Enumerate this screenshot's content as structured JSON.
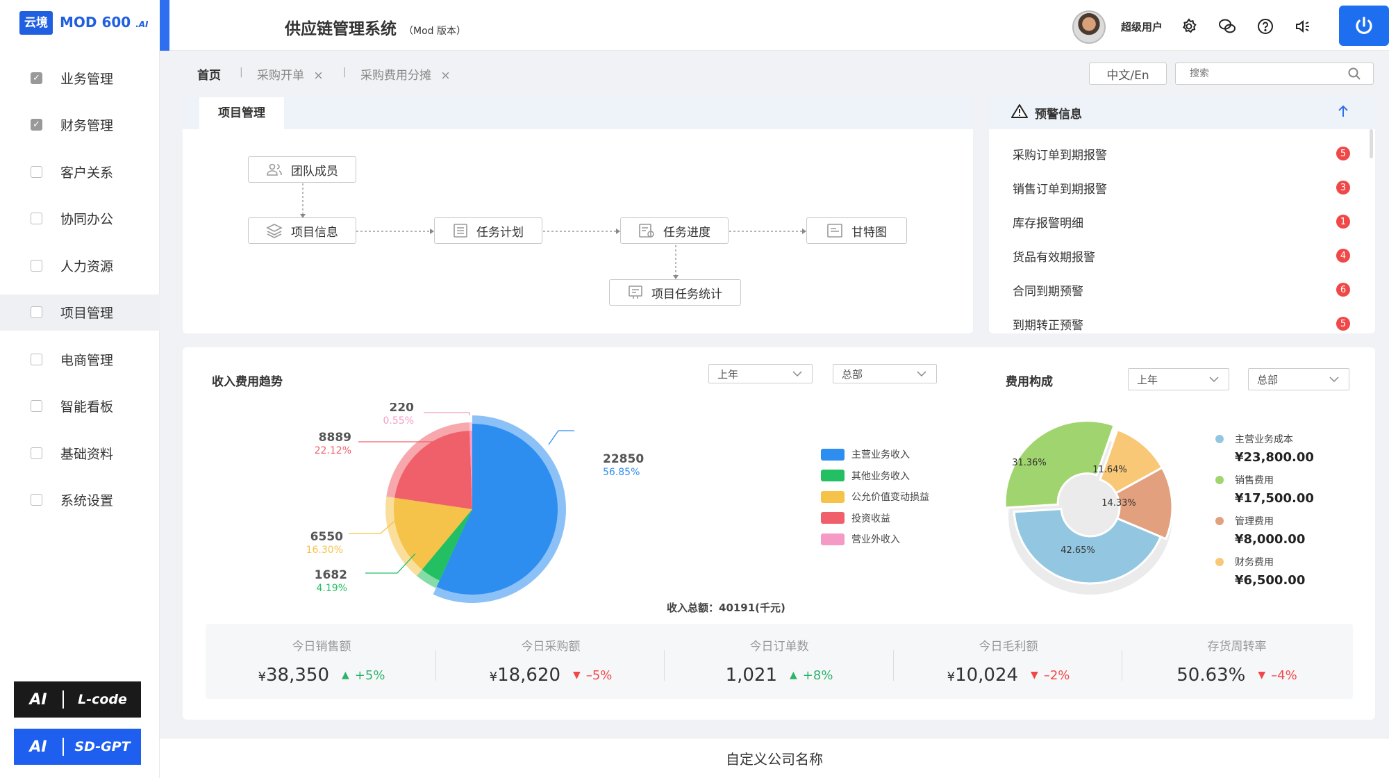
{
  "brand": {
    "badge": "云境",
    "name": "MOD 600",
    "suffix": ".AI"
  },
  "header": {
    "title": "供应链管理系统",
    "subtitle": "（Mod 版本）",
    "user": "超级用户"
  },
  "nav": [
    {
      "label": "业务管理",
      "checked": true
    },
    {
      "label": "财务管理",
      "checked": true
    },
    {
      "label": "客户关系",
      "checked": false
    },
    {
      "label": "协同办公",
      "checked": false
    },
    {
      "label": "人力资源",
      "checked": false
    },
    {
      "label": "项目管理",
      "checked": false,
      "active": true
    },
    {
      "label": "电商管理",
      "checked": false
    },
    {
      "label": "智能看板",
      "checked": false
    },
    {
      "label": "基础资料",
      "checked": false
    },
    {
      "label": "系统设置",
      "checked": false
    }
  ],
  "ai_buttons": [
    {
      "a": "AI",
      "b": "L-code",
      "color": "#1a1a1a"
    },
    {
      "a": "AI",
      "b": "SD-GPT",
      "color": "#1e5ff0"
    }
  ],
  "tabs": {
    "home": "首页",
    "t1": "采购开单",
    "t2": "采购费用分摊",
    "close": "×",
    "sep": "|"
  },
  "lang": "中文/En",
  "search": {
    "placeholder": "搜索"
  },
  "project": {
    "tab": "项目管理",
    "nodes": {
      "team": "团队成员",
      "info": "项目信息",
      "plan": "任务计划",
      "progress": "任务进度",
      "gantt": "甘特图",
      "stats": "项目任务统计"
    }
  },
  "warnings": {
    "title": "预警信息",
    "items": [
      {
        "label": "采购订单到期报警",
        "count": "5"
      },
      {
        "label": "销售订单到期报警",
        "count": "3"
      },
      {
        "label": "库存报警明细",
        "count": "1"
      },
      {
        "label": "货品有效期报警",
        "count": "4"
      },
      {
        "label": "合同到期预警",
        "count": "6"
      },
      {
        "label": "到期转正预警",
        "count": "5"
      }
    ]
  },
  "income": {
    "title": "收入费用趋势",
    "sel_period": "上年",
    "sel_dept": "总部",
    "total": "收入总额：40191(千元)"
  },
  "cost": {
    "title": "费用构成",
    "sel_period": "上年",
    "sel_dept": "总部"
  },
  "chart_data": [
    {
      "type": "pie",
      "categories": [
        "主营业务收入",
        "其他业务收入",
        "公允价值变动损益",
        "投资收益",
        "营业外收入"
      ],
      "values": [
        22850,
        1682,
        6550,
        8889,
        220
      ],
      "labels": [
        "22850",
        "1682",
        "6550",
        "8889",
        "220"
      ],
      "percents": [
        "56.85%",
        "4.19%",
        "16.30%",
        "22.12%",
        "0.55%"
      ],
      "colors": [
        "#2e8ef0",
        "#22c062",
        "#f5c24a",
        "#f0606a",
        "#f59ac4"
      ],
      "legend": "right"
    },
    {
      "type": "pie",
      "donut": true,
      "categories": [
        "主营业务成本",
        "销售费用",
        "管理费用",
        "财务费用"
      ],
      "values": [
        23800,
        17500,
        8000,
        6500
      ],
      "amounts": [
        "¥23,800.00",
        "¥17,500.00",
        "¥8,000.00",
        "¥6,500.00"
      ],
      "percents": [
        "42.65%",
        "31.36%",
        "14.33%",
        "11.64%"
      ],
      "colors": [
        "#93c6e0",
        "#a0d46e",
        "#e2a07e",
        "#f8c877"
      ],
      "legend": "right"
    }
  ],
  "stats": [
    {
      "label": "今日销售额",
      "cur": "¥",
      "value": "38,350",
      "change": "+5%",
      "dir": "up"
    },
    {
      "label": "今日采购额",
      "cur": "¥",
      "value": "18,620",
      "change": "–5%",
      "dir": "down"
    },
    {
      "label": "今日订单数",
      "cur": "",
      "value": "1,021",
      "change": "+8%",
      "dir": "up"
    },
    {
      "label": "今日毛利额",
      "cur": "¥",
      "value": "10,024",
      "change": "–2%",
      "dir": "down"
    },
    {
      "label": "存货周转率",
      "cur": "",
      "value": "50.63%",
      "change": "–4%",
      "dir": "down"
    }
  ],
  "footer": "自定义公司名称"
}
